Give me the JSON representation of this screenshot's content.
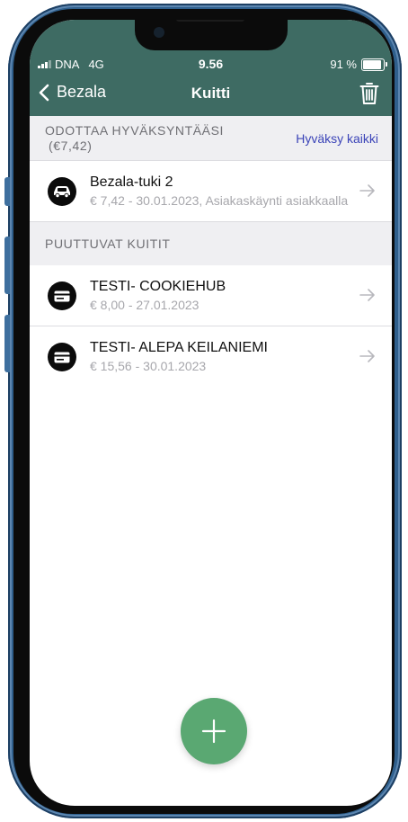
{
  "status_bar": {
    "carrier": "DNA",
    "network": "4G",
    "time": "9.56",
    "battery": "91 %"
  },
  "nav": {
    "back_label": "Bezala",
    "title": "Kuitti"
  },
  "pending": {
    "header_line1": "ODOTTAA HYVÄKSYNTÄÄSI",
    "header_line2": "(€7,42)",
    "action": "Hyväksy kaikki",
    "items": [
      {
        "title": "Bezala-tuki 2",
        "subtitle": "€ 7,42 - 30.01.2023, Asiakaskäynti asiakkaalla"
      }
    ]
  },
  "missing": {
    "header": "PUUTTUVAT KUITIT",
    "items": [
      {
        "title": "TESTI- COOKIEHUB",
        "subtitle": "€ 8,00 - 27.01.2023"
      },
      {
        "title": "TESTI- ALEPA KEILANIEMI",
        "subtitle": "€ 15,56 - 30.01.2023"
      }
    ]
  },
  "colors": {
    "header_bg": "#3e6b63",
    "accent_link": "#3b44b8",
    "fab": "#5aa872"
  },
  "icons": {
    "back": "chevron-left-icon",
    "trash": "trash-icon",
    "car": "car-icon",
    "card": "credit-card-icon",
    "arrow": "arrow-right-icon",
    "add": "plus-icon"
  }
}
